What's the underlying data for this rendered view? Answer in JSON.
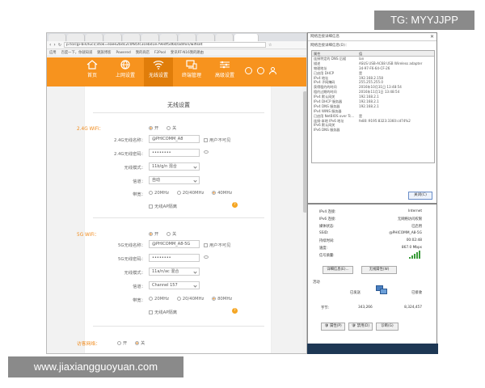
{
  "watermarks": {
    "top": "TG: MYYJJPP",
    "bottom": "www.jiaxiangguoyuan.com"
  },
  "browser": {
    "url": "p.to/cgi-bin/luci/;stok=eaee2bdc2c0f85fc3cebd1e79edf5d60/admin/wifiset",
    "bookmarks": [
      "应用",
      "百度一下，你就知道",
      "魅族博客",
      "Powered",
      "我的商店",
      "F2Pool",
      "斐讯RT-N16我的路由"
    ]
  },
  "router": {
    "nav": [
      {
        "label": "首页",
        "icon": "home-icon"
      },
      {
        "label": "上网设置",
        "icon": "globe-icon"
      },
      {
        "label": "无线设置",
        "icon": "wifi-icon"
      },
      {
        "label": "终端管理",
        "icon": "devices-icon"
      },
      {
        "label": "高级设置",
        "icon": "sliders-icon"
      }
    ],
    "page_title": "无线设置",
    "wifi24": {
      "section_label": "2.4G WiFi：",
      "switch_on": "开",
      "switch_off": "关",
      "ssid_label": "2.4G无线名称：",
      "ssid_value": "@PHICOMM_A8",
      "hide_label": "用户不可见",
      "pwd_label": "2.4G无线密码：",
      "pwd_value": "••••••••",
      "mode_label": "无线模式：",
      "mode_value": "11b/g/n 混合",
      "channel_label": "信道：",
      "channel_value": "自动",
      "bw_label": "带宽：",
      "bw_opts": [
        "20MHz",
        "20/40MHz",
        "40MHz"
      ],
      "ap_label": "无线AP隔离"
    },
    "wifi5": {
      "section_label": "5G WiFi：",
      "switch_on": "开",
      "switch_off": "关",
      "ssid_label": "5G无线名称：",
      "ssid_value": "@PHICOMM_A8-5G",
      "hide_label": "用户不可见",
      "pwd_label": "5G无线密码：",
      "pwd_value": "••••••••",
      "mode_label": "无线模式：",
      "mode_value": "11a/n/ac 混合",
      "channel_label": "信道：",
      "channel_value": "Channel 157",
      "bw_label": "带宽：",
      "bw_opts": [
        "20MHz",
        "20/40MHz",
        "80MHz"
      ],
      "ap_label": "无线AP隔离"
    },
    "guest": {
      "section_label": "访客网络：",
      "switch_on": "开",
      "switch_off": "关"
    }
  },
  "details": {
    "title": "网络连接详细信息",
    "subtitle": "网络连接详细信息(D)：",
    "header": {
      "k": "属性",
      "v": "值"
    },
    "rows": [
      {
        "k": "连接特定的 DNS 后缀",
        "v": "lan"
      },
      {
        "k": "描述",
        "v": "ASUS USB-AC68 USB Wireless adapter"
      },
      {
        "k": "物理地址",
        "v": "34-97-F6-64-CF-26"
      },
      {
        "k": "已启用 DHCP",
        "v": "是"
      },
      {
        "k": "IPv4 地址",
        "v": "192.168.2.158"
      },
      {
        "k": "IPv4 子网掩码",
        "v": "255.255.255.0"
      },
      {
        "k": "获得租约的时间",
        "v": "2016年10月31日 13:48:54"
      },
      {
        "k": "租约过期的时间",
        "v": "2016年11月1日 13:48:54"
      },
      {
        "k": "IPv4 默认网关",
        "v": "192.168.2.1"
      },
      {
        "k": "IPv4 DHCP 服务器",
        "v": "192.168.2.1"
      },
      {
        "k": "IPv4 DNS 服务器",
        "v": "192.168.2.1"
      },
      {
        "k": "IPv4 WINS 服务器",
        "v": ""
      },
      {
        "k": "已启用 NetBIOS over Tc...",
        "v": "是"
      },
      {
        "k": "连接-本地 IPv6 地址",
        "v": "fe80::9195:8323:3360:cd74%2"
      },
      {
        "k": "IPv6 默认网关",
        "v": ""
      },
      {
        "k": "IPv6 DNS 服务器",
        "v": ""
      }
    ],
    "close": "关闭(C)"
  },
  "status": {
    "rows": [
      {
        "k": "IPv4 连接:",
        "v": "Internet"
      },
      {
        "k": "IPv6 连接:",
        "v": "无网络访问权限"
      },
      {
        "k": "媒体状态:",
        "v": "已启用"
      },
      {
        "k": "SSID:",
        "v": "@PHICOMM_A8-5G"
      },
      {
        "k": "持续时间:",
        "v": "00:02:48"
      },
      {
        "k": "速度:",
        "v": "867.0 Mbps"
      },
      {
        "k": "信号质量:",
        "v": ""
      }
    ],
    "btn_details": "详细信息(E)...",
    "btn_wireless": "无线属性(W)",
    "activity": "活动",
    "sent": "已发送",
    "received": "已接收",
    "bytes_label": "字节:",
    "bytes_sent": "343,266",
    "bytes_recv": "8,324,457",
    "btn_props": "属性(P)",
    "btn_disable": "禁用(D)",
    "btn_diag": "诊断(G)"
  }
}
